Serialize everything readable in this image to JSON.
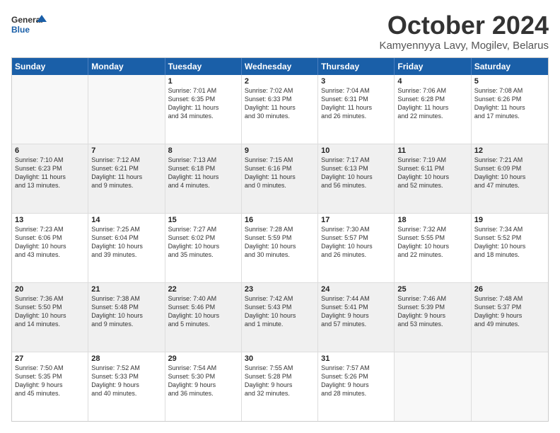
{
  "header": {
    "logo_line1": "General",
    "logo_line2": "Blue",
    "title": "October 2024",
    "subtitle": "Kamyennyya Lavy, Mogilev, Belarus"
  },
  "days": [
    "Sunday",
    "Monday",
    "Tuesday",
    "Wednesday",
    "Thursday",
    "Friday",
    "Saturday"
  ],
  "rows": [
    [
      {
        "num": "",
        "text": ""
      },
      {
        "num": "",
        "text": ""
      },
      {
        "num": "1",
        "text": "Sunrise: 7:01 AM\nSunset: 6:35 PM\nDaylight: 11 hours\nand 34 minutes."
      },
      {
        "num": "2",
        "text": "Sunrise: 7:02 AM\nSunset: 6:33 PM\nDaylight: 11 hours\nand 30 minutes."
      },
      {
        "num": "3",
        "text": "Sunrise: 7:04 AM\nSunset: 6:31 PM\nDaylight: 11 hours\nand 26 minutes."
      },
      {
        "num": "4",
        "text": "Sunrise: 7:06 AM\nSunset: 6:28 PM\nDaylight: 11 hours\nand 22 minutes."
      },
      {
        "num": "5",
        "text": "Sunrise: 7:08 AM\nSunset: 6:26 PM\nDaylight: 11 hours\nand 17 minutes."
      }
    ],
    [
      {
        "num": "6",
        "text": "Sunrise: 7:10 AM\nSunset: 6:23 PM\nDaylight: 11 hours\nand 13 minutes."
      },
      {
        "num": "7",
        "text": "Sunrise: 7:12 AM\nSunset: 6:21 PM\nDaylight: 11 hours\nand 9 minutes."
      },
      {
        "num": "8",
        "text": "Sunrise: 7:13 AM\nSunset: 6:18 PM\nDaylight: 11 hours\nand 4 minutes."
      },
      {
        "num": "9",
        "text": "Sunrise: 7:15 AM\nSunset: 6:16 PM\nDaylight: 11 hours\nand 0 minutes."
      },
      {
        "num": "10",
        "text": "Sunrise: 7:17 AM\nSunset: 6:13 PM\nDaylight: 10 hours\nand 56 minutes."
      },
      {
        "num": "11",
        "text": "Sunrise: 7:19 AM\nSunset: 6:11 PM\nDaylight: 10 hours\nand 52 minutes."
      },
      {
        "num": "12",
        "text": "Sunrise: 7:21 AM\nSunset: 6:09 PM\nDaylight: 10 hours\nand 47 minutes."
      }
    ],
    [
      {
        "num": "13",
        "text": "Sunrise: 7:23 AM\nSunset: 6:06 PM\nDaylight: 10 hours\nand 43 minutes."
      },
      {
        "num": "14",
        "text": "Sunrise: 7:25 AM\nSunset: 6:04 PM\nDaylight: 10 hours\nand 39 minutes."
      },
      {
        "num": "15",
        "text": "Sunrise: 7:27 AM\nSunset: 6:02 PM\nDaylight: 10 hours\nand 35 minutes."
      },
      {
        "num": "16",
        "text": "Sunrise: 7:28 AM\nSunset: 5:59 PM\nDaylight: 10 hours\nand 30 minutes."
      },
      {
        "num": "17",
        "text": "Sunrise: 7:30 AM\nSunset: 5:57 PM\nDaylight: 10 hours\nand 26 minutes."
      },
      {
        "num": "18",
        "text": "Sunrise: 7:32 AM\nSunset: 5:55 PM\nDaylight: 10 hours\nand 22 minutes."
      },
      {
        "num": "19",
        "text": "Sunrise: 7:34 AM\nSunset: 5:52 PM\nDaylight: 10 hours\nand 18 minutes."
      }
    ],
    [
      {
        "num": "20",
        "text": "Sunrise: 7:36 AM\nSunset: 5:50 PM\nDaylight: 10 hours\nand 14 minutes."
      },
      {
        "num": "21",
        "text": "Sunrise: 7:38 AM\nSunset: 5:48 PM\nDaylight: 10 hours\nand 9 minutes."
      },
      {
        "num": "22",
        "text": "Sunrise: 7:40 AM\nSunset: 5:46 PM\nDaylight: 10 hours\nand 5 minutes."
      },
      {
        "num": "23",
        "text": "Sunrise: 7:42 AM\nSunset: 5:43 PM\nDaylight: 10 hours\nand 1 minute."
      },
      {
        "num": "24",
        "text": "Sunrise: 7:44 AM\nSunset: 5:41 PM\nDaylight: 9 hours\nand 57 minutes."
      },
      {
        "num": "25",
        "text": "Sunrise: 7:46 AM\nSunset: 5:39 PM\nDaylight: 9 hours\nand 53 minutes."
      },
      {
        "num": "26",
        "text": "Sunrise: 7:48 AM\nSunset: 5:37 PM\nDaylight: 9 hours\nand 49 minutes."
      }
    ],
    [
      {
        "num": "27",
        "text": "Sunrise: 7:50 AM\nSunset: 5:35 PM\nDaylight: 9 hours\nand 45 minutes."
      },
      {
        "num": "28",
        "text": "Sunrise: 7:52 AM\nSunset: 5:33 PM\nDaylight: 9 hours\nand 40 minutes."
      },
      {
        "num": "29",
        "text": "Sunrise: 7:54 AM\nSunset: 5:30 PM\nDaylight: 9 hours\nand 36 minutes."
      },
      {
        "num": "30",
        "text": "Sunrise: 7:55 AM\nSunset: 5:28 PM\nDaylight: 9 hours\nand 32 minutes."
      },
      {
        "num": "31",
        "text": "Sunrise: 7:57 AM\nSunset: 5:26 PM\nDaylight: 9 hours\nand 28 minutes."
      },
      {
        "num": "",
        "text": ""
      },
      {
        "num": "",
        "text": ""
      }
    ]
  ]
}
